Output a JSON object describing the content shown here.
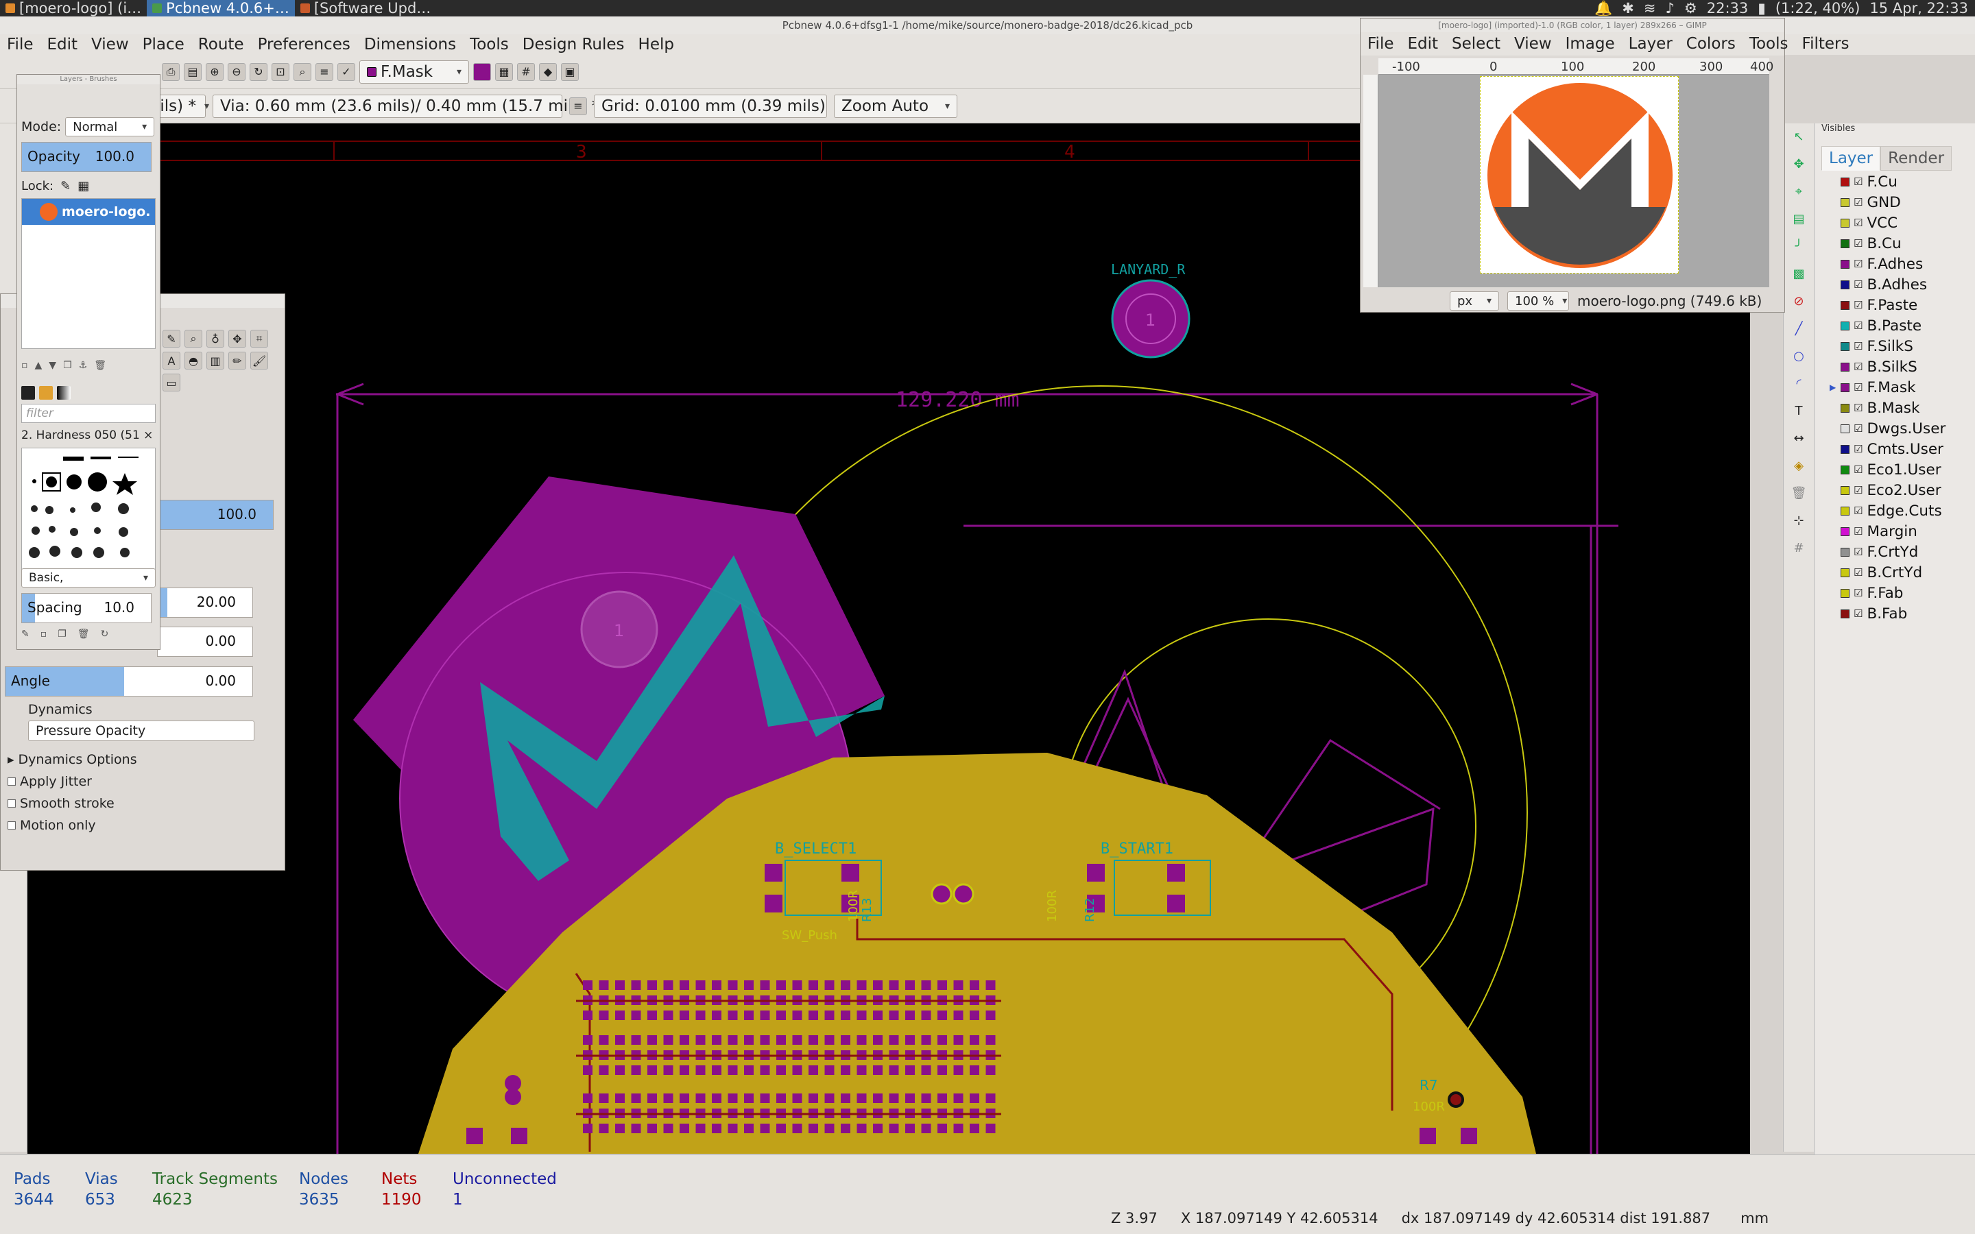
{
  "taskbar": {
    "tasks": [
      "[moero-logo] (i…",
      "Pcbnew 4.0.6+…",
      "[Software Upd…"
    ],
    "clock1": "22:33",
    "battery": "(1:22, 40%)",
    "date": "15 Apr, 22:33"
  },
  "pcbnew": {
    "title": "Pcbnew 4.0.6+dfsg1-1 /home/mike/source/monero-badge-2018/dc26.kicad_pcb",
    "menu": [
      "File",
      "Edit",
      "View",
      "Place",
      "Route",
      "Preferences",
      "Dimensions",
      "Tools",
      "Design Rules",
      "Help"
    ],
    "layer_combo": "F.Mask",
    "track_combo": "mils) *",
    "via_combo": "Via: 0.60 mm (23.6 mils)/ 0.40 mm (15.7 mils) *",
    "grid_combo": "Grid: 0.0100 mm (0.39 mils)",
    "zoom_combo": "Zoom Auto",
    "canvas": {
      "dimension_text": "129.220 mm",
      "lanyard_label": "LANYARD_R",
      "pad_number": "1",
      "sheet_cols": [
        "3",
        "4"
      ],
      "b_select": "B_SELECT1",
      "b_start": "B_START1",
      "sw_push": "SW_Push",
      "r13": "R13",
      "r12": "R12",
      "r7": "R7",
      "r7_val": "100R",
      "r_val": "100R"
    }
  },
  "stats": [
    {
      "label": "Pads",
      "value": "3644",
      "color": "#1d4fa3"
    },
    {
      "label": "Vias",
      "value": "653",
      "color": "#1d4fa3"
    },
    {
      "label": "Track Segments",
      "value": "4623",
      "color": "#2a6e2a"
    },
    {
      "label": "Nodes",
      "value": "3635",
      "color": "#1d4fa3"
    },
    {
      "label": "Nets",
      "value": "1190",
      "color": "#b00000"
    },
    {
      "label": "Unconnected",
      "value": "1",
      "color": "#1a1aa0"
    }
  ],
  "coords": {
    "zoom": "Z 3.97",
    "xy": "X 187.097149  Y 42.605314",
    "delta": "dx 187.097149  dy 42.605314  dist 191.887",
    "units": "mm"
  },
  "layers": {
    "visibles_label": "Visibles",
    "tabs": [
      "Layer",
      "Render"
    ],
    "items": [
      {
        "name": "F.Cu",
        "color": "#b01010"
      },
      {
        "name": "GND",
        "color": "#c8c830"
      },
      {
        "name": "VCC",
        "color": "#c8c830"
      },
      {
        "name": "B.Cu",
        "color": "#107010"
      },
      {
        "name": "F.Adhes",
        "color": "#8a108a"
      },
      {
        "name": "B.Adhes",
        "color": "#10108a"
      },
      {
        "name": "F.Paste",
        "color": "#8a1010"
      },
      {
        "name": "B.Paste",
        "color": "#10b0b0"
      },
      {
        "name": "F.SilkS",
        "color": "#108a8a"
      },
      {
        "name": "B.SilkS",
        "color": "#8a108a"
      },
      {
        "name": "F.Mask",
        "color": "#8a108a"
      },
      {
        "name": "B.Mask",
        "color": "#8a8a10"
      },
      {
        "name": "Dwgs.User",
        "color": "#e0e0e0"
      },
      {
        "name": "Cmts.User",
        "color": "#10108a"
      },
      {
        "name": "Eco1.User",
        "color": "#108a10"
      },
      {
        "name": "Eco2.User",
        "color": "#c8c810"
      },
      {
        "name": "Edge.Cuts",
        "color": "#c8c810"
      },
      {
        "name": "Margin",
        "color": "#d010d0"
      },
      {
        "name": "F.CrtYd",
        "color": "#909090"
      },
      {
        "name": "B.CrtYd",
        "color": "#c8c810"
      },
      {
        "name": "F.Fab",
        "color": "#c8c810"
      },
      {
        "name": "B.Fab",
        "color": "#8a1010"
      }
    ]
  },
  "gimp_image": {
    "title": "[moero-logo] (imported)-1.0 (RGB color, 1 layer) 289x266 – GIMP",
    "menu": [
      "File",
      "Edit",
      "Select",
      "View",
      "Image",
      "Layer",
      "Colors",
      "Tools",
      "Filters"
    ],
    "ruler": [
      "-100",
      "0",
      "100",
      "200",
      "300",
      "400"
    ],
    "unit": "px",
    "zoom": "100 %",
    "status": "moero-logo.png (749.6 kB)"
  },
  "gimp_layers": {
    "title": "Layers - Brushes",
    "mode_label": "Mode:",
    "mode_value": "Normal",
    "opacity_label": "Opacity",
    "opacity_value": "100.0",
    "lock_label": "Lock:",
    "layer_name": "moero-logo."
  },
  "gimp_tools": {
    "filter_placeholder": "filter",
    "brush_name": "2. Hardness 050 (51 × …",
    "brush_set": "Basic,",
    "spacing_label": "Spacing",
    "spacing_value": "10.0",
    "opacity_value": "100.0",
    "size_value": "20.00",
    "aspect_value": "0.00",
    "angle_label": "Angle",
    "angle_value": "0.00",
    "dynamics_label": "Dynamics",
    "dynamics_value": "Pressure Opacity",
    "dynamics_options": "Dynamics Options",
    "apply_jitter": "Apply Jitter",
    "smooth_stroke": "Smooth stroke",
    "motion_only": "Motion only"
  }
}
